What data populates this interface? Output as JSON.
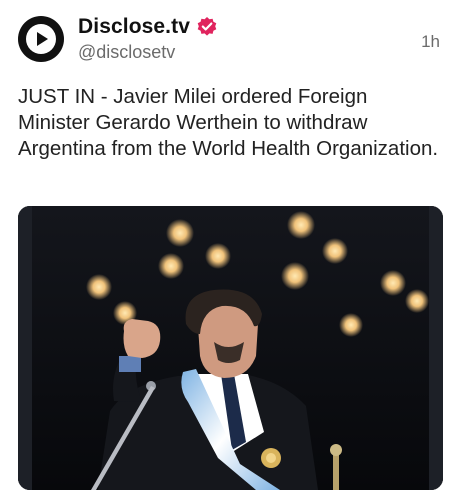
{
  "post": {
    "display_name": "Disclose.tv",
    "handle": "@disclosetv",
    "time": "1h",
    "text": "JUST IN - Javier Milei ordered Foreign Minister Gerardo Werthein to withdraw Argentina from the World Health Organization.",
    "avatar_icon": "play-logo-icon",
    "verified_icon": "verified-badge-icon",
    "colors": {
      "verified_badge": "#e0245e",
      "text": "#222222",
      "secondary": "#6b6b6b"
    }
  }
}
